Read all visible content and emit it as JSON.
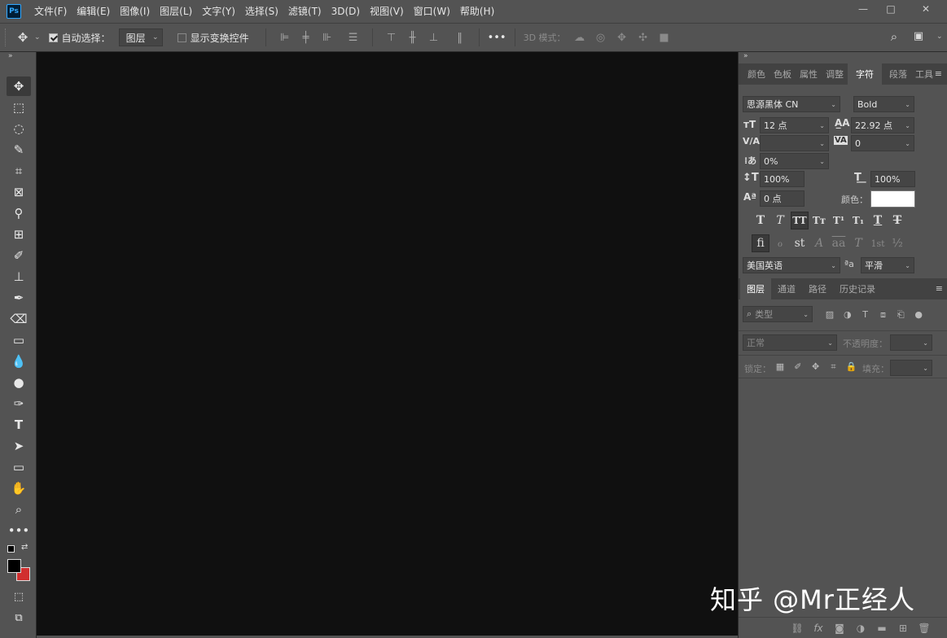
{
  "app": {
    "logo": "Ps",
    "menu": [
      "文件(F)",
      "编辑(E)",
      "图像(I)",
      "图层(L)",
      "文字(Y)",
      "选择(S)",
      "滤镜(T)",
      "3D(D)",
      "视图(V)",
      "窗口(W)",
      "帮助(H)"
    ],
    "window_buttons": [
      "—",
      "□",
      "✕"
    ]
  },
  "options": {
    "auto_select_label": "自动选择：",
    "auto_select_checked": true,
    "auto_select_target": "图层",
    "show_transform_label": "显示变换控件",
    "more": "•••",
    "mode_3d_label": "3D 模式："
  },
  "character_panel": {
    "tabs": [
      "颜色",
      "色板",
      "属性",
      "调整",
      "字符",
      "段落",
      "工具"
    ],
    "active_tab": "字符",
    "font_family": "思源黑体 CN",
    "font_style": "Bold",
    "font_size": "12 点",
    "leading": "22.92 点",
    "kerning": "",
    "tracking": "0",
    "scale_tsume": "0%",
    "vertical_scale": "100%",
    "horizontal_scale": "100%",
    "baseline_shift": "0 点",
    "color_label": "颜色：",
    "color_value": "#ffffff",
    "style_buttons": [
      "T",
      "T",
      "TT",
      "Tт",
      "T¹",
      "T₁",
      "T",
      "T"
    ],
    "opentype_buttons": [
      "fi",
      "ℴ",
      "st",
      "A",
      "aa",
      "T",
      "1st",
      "½"
    ],
    "language": "美国英语",
    "antialias_label": "ªa",
    "antialias": "平滑"
  },
  "layers_panel": {
    "tabs": [
      "图层",
      "通道",
      "路径",
      "历史记录"
    ],
    "active_tab": "图层",
    "filter_kind": "类型",
    "blend_mode": "正常",
    "opacity_label": "不透明度：",
    "lock_label": "锁定：",
    "fill_label": "填充："
  },
  "watermark": "知乎 @Mr正经人"
}
